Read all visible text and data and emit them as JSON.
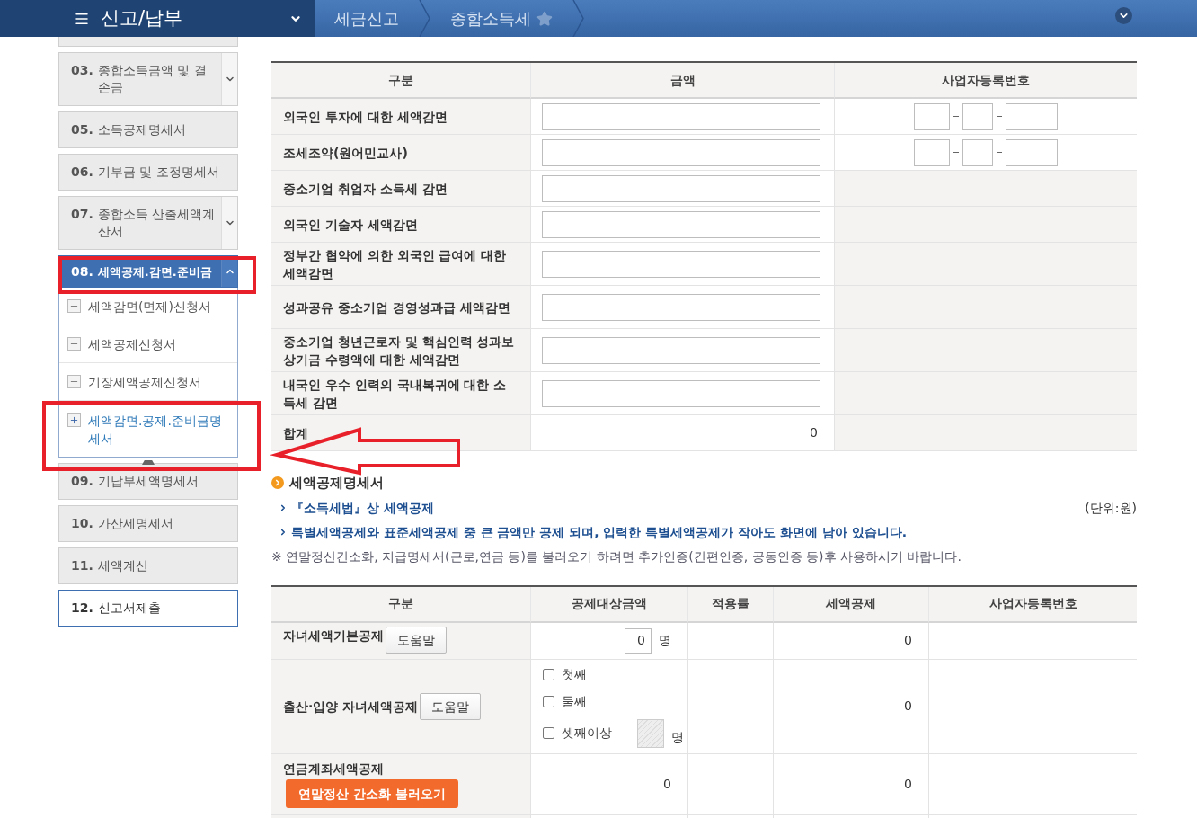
{
  "header": {
    "menu_title": "신고/납부",
    "breadcrumb": [
      "세금신고",
      "종합소득세"
    ]
  },
  "sidebar": {
    "items": [
      {
        "number": "03.",
        "label": "종합소득금액 및 결손금",
        "expanded": false,
        "selected": false
      },
      {
        "number": "05.",
        "label": "소득공제명세서",
        "selected": false
      },
      {
        "number": "06.",
        "label": "기부금 및 조정명세서",
        "selected": false
      },
      {
        "number": "07.",
        "label": "종합소득 산출세액계산서",
        "expanded": false,
        "selected": false
      },
      {
        "number": "08.",
        "label": "세액공제.감면.준비금",
        "expanded": true,
        "selected": false,
        "children": [
          {
            "label": "세액감면(면제)신청서",
            "kind": "minus",
            "selected": false
          },
          {
            "label": "세액공제신청서",
            "kind": "minus",
            "selected": false
          },
          {
            "label": "기장세액공제신청서",
            "kind": "minus",
            "selected": false
          },
          {
            "label": "세액감면.공제.준비금명세서",
            "kind": "plus",
            "selected": true
          }
        ]
      },
      {
        "number": "09.",
        "label": "기납부세액명세서",
        "selected": false
      },
      {
        "number": "10.",
        "label": "가산세명세서",
        "selected": false
      },
      {
        "number": "11.",
        "label": "세액계산",
        "selected": false
      },
      {
        "number": "12.",
        "label": "신고서제출",
        "selected": true
      }
    ]
  },
  "reduction_table": {
    "columns": [
      "구분",
      "금액",
      "사업자등록번호"
    ],
    "rows": [
      {
        "label": "외국인 투자에 대한 세액감면",
        "business_number": true
      },
      {
        "label": "조세조약(원어민교사)",
        "business_number": true
      },
      {
        "label": "중소기업 취업자 소득세 감면",
        "business_number": false
      },
      {
        "label": "외국인 기술자 세액감면",
        "business_number": false
      },
      {
        "label": "정부간 협약에 의한 외국인 급여에 대한 세액감면",
        "business_number": false
      },
      {
        "label": "성과공유 중소기업 경영성과급 세액감면",
        "business_number": false
      },
      {
        "label": "중소기업 청년근로자 및 핵심인력 성과보상기금 수령액에 대한 세액감면",
        "business_number": false
      },
      {
        "label": "내국인 우수 인력의 국내복귀에 대한 소득세 감면",
        "business_number": false
      }
    ],
    "total": {
      "label": "합계",
      "value": "0"
    }
  },
  "credit_section": {
    "title": "세액공제명세서",
    "links": [
      "『소득세법』상 세액공제",
      "특별세액공제와 표준세액공제 중 큰 금액만 공제 되며, 입력한 특별세액공제가 작아도 화면에 남아 있습니다."
    ],
    "unit": "(단위:원)",
    "note": "※ 연말정산간소화, 지급명세서(근로,연금 등)를 불러오기 하려면 추가인증(간편인증, 공동인증 등)후 사용하시기 바랍니다."
  },
  "credit_table": {
    "columns": [
      "구분",
      "공제대상금액",
      "적용률",
      "세액공제",
      "사업자등록번호"
    ],
    "rows": [
      {
        "kind": "count",
        "label": "자녀세액기본공제",
        "help": "도움말",
        "count": "0",
        "unit": "명",
        "credit": "0"
      },
      {
        "kind": "checks",
        "label": "출산·입양 자녀세액공제",
        "help": "도움말",
        "checks": [
          {
            "label": "첫째",
            "checked": false
          },
          {
            "label": "둘째",
            "checked": false
          },
          {
            "label": "셋째이상",
            "checked": false
          }
        ],
        "unit": "명",
        "credit": "0"
      },
      {
        "kind": "amount",
        "label": "연금계좌세액공제",
        "button": "연말정산 간소화 불러오기",
        "amount": "0",
        "credit": "0"
      }
    ]
  }
}
